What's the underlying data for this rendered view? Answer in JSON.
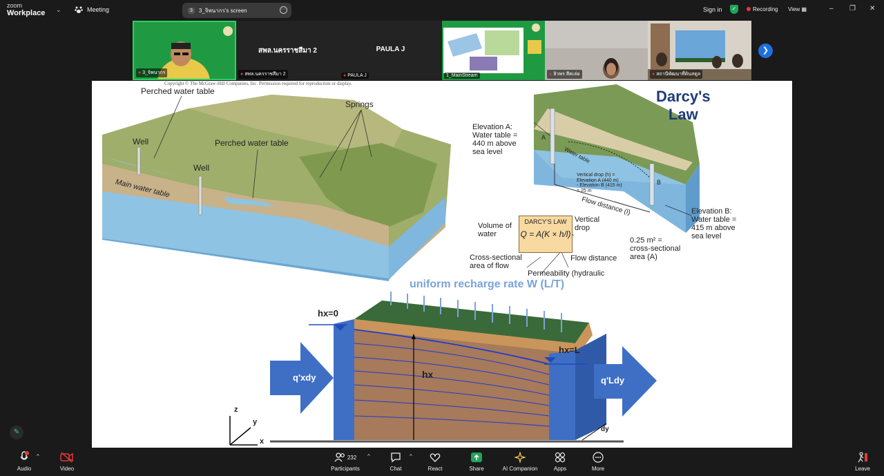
{
  "app": {
    "brand_small": "zoom",
    "brand_big": "Workplace",
    "meeting_label": "Meeting"
  },
  "share_pill": {
    "count": "3",
    "title": "3_จิพนากร's screen"
  },
  "top_right": {
    "sign_in": "Sign in",
    "recording": "Recording",
    "view": "View"
  },
  "thumbnails": [
    {
      "name": "3_จิพนากร",
      "big_name": "",
      "muted": true
    },
    {
      "name": "สพล.นครราชสีมา 2",
      "big_name": "สพล.นครราชสีมา 2",
      "muted": true
    },
    {
      "name": "PAULA J",
      "big_name": "PAULA J",
      "muted": true
    },
    {
      "name": "1_MainStream",
      "big_name": "",
      "muted": false
    },
    {
      "name": "ลิวพร สีคเล่ย",
      "big_name": "",
      "muted": true
    },
    {
      "name": "สถานีพัฒนาที่ดินสตูล",
      "big_name": "",
      "muted": true
    }
  ],
  "slide": {
    "copyright": "Copyright © The McGraw-Hill Companies, Inc. Permission required for reproduction or display.",
    "left_labels": {
      "perched_top": "Perched water table",
      "perched_mid": "Perched water table",
      "springs": "Springs",
      "well1": "Well",
      "well2": "Well",
      "main_table": "Main water table"
    },
    "darcy": {
      "title_line1": "Darcy's",
      "title_line2": "Law",
      "elev_a": "Elevation A:\nWater table =\n440 m above\nsea level",
      "elev_b": "Elevation B:\nWater table =\n415 m above\nsea level",
      "water_table": "Water table",
      "vertical_drop_note": "Vertical drop (h) =\nElevation A (440 m)\n- Elevation B (415 m)\n= 25 m",
      "flow_distance": "Flow distance (l)",
      "point_a": "A",
      "point_b": "B",
      "box_heading": "DARCY'S LAW",
      "formula": "Q = A(K × h/l)",
      "volume": "Volume of\nwater",
      "vertical_drop": "Vertical\ndrop",
      "cross_section": "Cross-sectional\narea of flow",
      "flow_dist": "Flow distance",
      "permeability": "Permeability (hydraulic",
      "area": "0.25 m² =\ncross-sectional\narea (A)"
    },
    "recharge": {
      "title": "uniform recharge rate W (L/T)",
      "h0": "hx=0",
      "hL": "hx=L",
      "hx": "hx",
      "qin": "q'xdy",
      "qout": "q'Ldy",
      "dy": "dy",
      "axis_z": "z",
      "axis_y": "y",
      "axis_x": "x"
    }
  },
  "bottom": {
    "audio": "Audio",
    "video": "Video",
    "participants": "Participants",
    "participant_count": "232",
    "chat": "Chat",
    "react": "React",
    "share": "Share",
    "ai": "AI Companion",
    "apps": "Apps",
    "more": "More",
    "leave": "Leave"
  },
  "colors": {
    "accent": "#1e6fe0",
    "recording": "#e53935",
    "share_green": "#22a35a",
    "slide_blue": "#3f6fc5"
  }
}
